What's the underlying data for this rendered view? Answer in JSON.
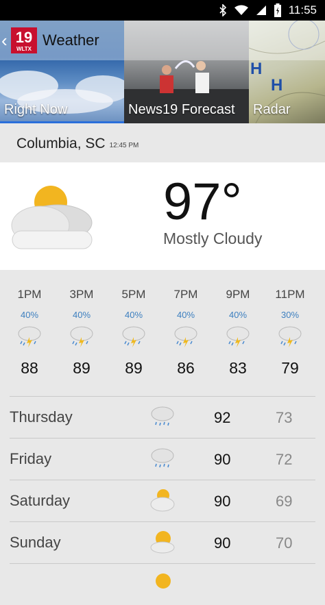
{
  "status_bar": {
    "time": "11:55",
    "icons": [
      "bluetooth-icon",
      "wifi-icon",
      "signal-icon",
      "battery-icon"
    ]
  },
  "app_bar": {
    "back_icon": "chevron-left-icon",
    "logo_number": "19",
    "logo_call": "WLTX",
    "title": "Weather"
  },
  "tabs": [
    {
      "label": "Right Now",
      "selected": true
    },
    {
      "label": "News19 Forecast",
      "selected": false
    },
    {
      "label": "Radar",
      "selected": false
    }
  ],
  "colors": {
    "accent": "#2a6fdb",
    "precip_blue": "#3d7fbf",
    "logo_red": "#c8102e"
  },
  "location": {
    "name": "Columbia, SC",
    "time": "12:45 PM"
  },
  "current": {
    "icon": "partly-cloudy-icon",
    "temperature": "97°",
    "condition": "Mostly Cloudy"
  },
  "hourly": [
    {
      "time": "1PM",
      "precip": "40%",
      "icon": "thunderstorm-icon",
      "temp": "88"
    },
    {
      "time": "3PM",
      "precip": "40%",
      "icon": "thunderstorm-icon",
      "temp": "89"
    },
    {
      "time": "5PM",
      "precip": "40%",
      "icon": "thunderstorm-icon",
      "temp": "89"
    },
    {
      "time": "7PM",
      "precip": "40%",
      "icon": "thunderstorm-icon",
      "temp": "86"
    },
    {
      "time": "9PM",
      "precip": "40%",
      "icon": "thunderstorm-icon",
      "temp": "83"
    },
    {
      "time": "11PM",
      "precip": "30%",
      "icon": "thunderstorm-icon",
      "temp": "79"
    }
  ],
  "daily": [
    {
      "day": "Thursday",
      "icon": "rain-cloud-icon",
      "high": "92",
      "low": "73"
    },
    {
      "day": "Friday",
      "icon": "rain-cloud-icon",
      "high": "90",
      "low": "72"
    },
    {
      "day": "Saturday",
      "icon": "partly-cloudy-icon",
      "high": "90",
      "low": "69"
    },
    {
      "day": "Sunday",
      "icon": "partly-cloudy-icon",
      "high": "90",
      "low": "70"
    }
  ]
}
